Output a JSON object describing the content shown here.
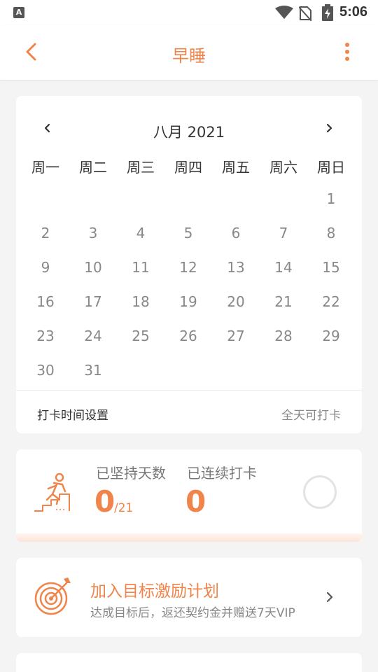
{
  "status_bar": {
    "time": "5:06",
    "app_badge": "A"
  },
  "app_bar": {
    "title": "早睡"
  },
  "calendar": {
    "month_label": "八月 2021",
    "weekdays": [
      "周一",
      "周二",
      "周三",
      "周四",
      "周五",
      "周六",
      "周日"
    ],
    "leading_blanks": 6,
    "days": [
      "1",
      "2",
      "3",
      "4",
      "5",
      "6",
      "7",
      "8",
      "9",
      "10",
      "11",
      "12",
      "13",
      "14",
      "15",
      "16",
      "17",
      "18",
      "19",
      "20",
      "21",
      "22",
      "23",
      "24",
      "25",
      "26",
      "27",
      "28",
      "29",
      "30",
      "31"
    ],
    "checkin_setting_label": "打卡时间设置",
    "checkin_setting_value": "全天可打卡"
  },
  "stats": {
    "persist_label": "已坚持天数",
    "persist_value": "0",
    "persist_total": "/21",
    "streak_label": "已连续打卡",
    "streak_value": "0"
  },
  "goal": {
    "title": "加入目标激励计划",
    "subtitle": "达成目标后，返还契约金并赠送7天VIP"
  },
  "colors": {
    "accent": "#f0844a",
    "background": "#f4f4f4"
  },
  "icons": {
    "back": "back-arrow-icon",
    "more": "more-vertical-icon",
    "prev": "chevron-left-icon",
    "next": "chevron-right-icon",
    "stairs": "climbing-stairs-icon",
    "target": "target-icon"
  }
}
